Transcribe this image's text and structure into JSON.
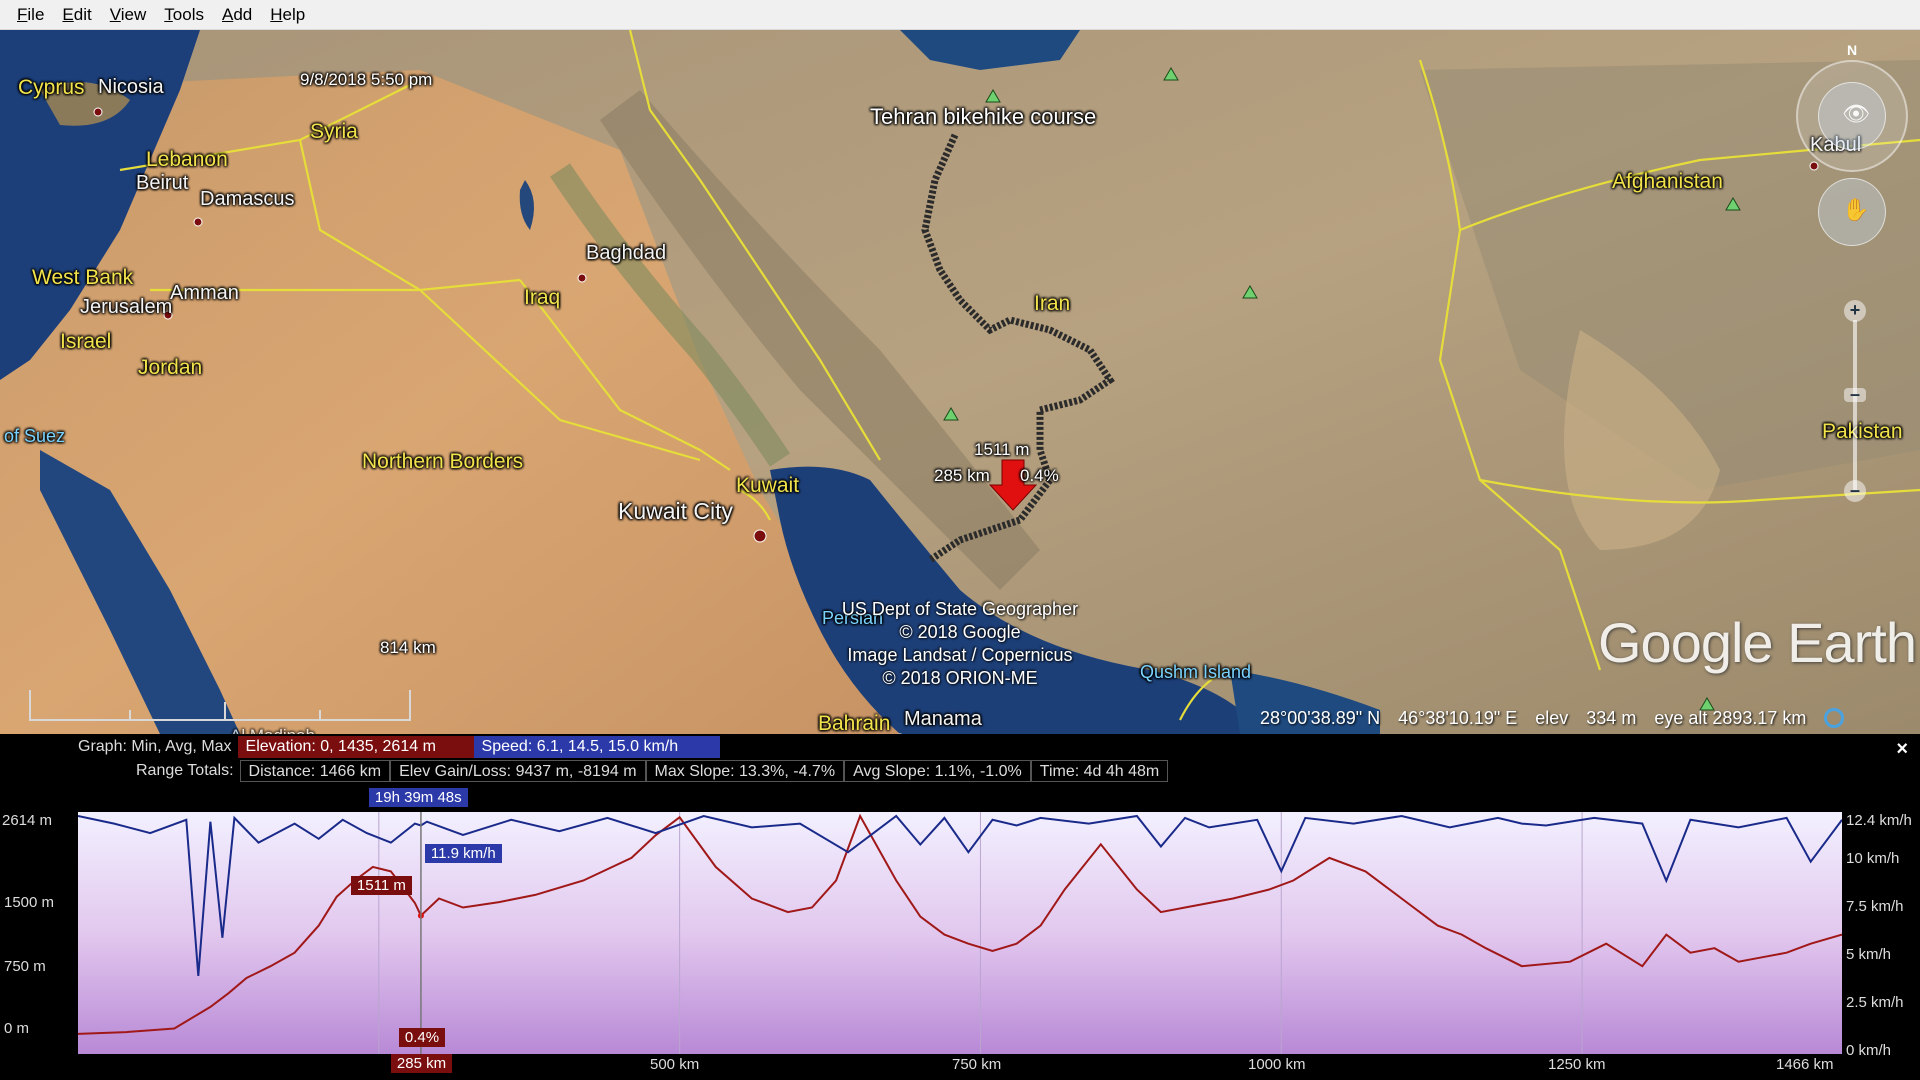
{
  "menu": [
    "File",
    "Edit",
    "View",
    "Tools",
    "Add",
    "Help"
  ],
  "map": {
    "timestamp": "9/8/2018   5:50 pm",
    "scale_label": "814 km",
    "labels": {
      "cyprus": "Cyprus",
      "nicosia": "Nicosia",
      "syria": "Syria",
      "lebanon": "Lebanon",
      "beirut": "Beirut",
      "damascus": "Damascus",
      "west_bank": "West Bank",
      "amman": "Amman",
      "jerusalem": "Jerusalem",
      "israel": "Israel",
      "jordan": "Jordan",
      "suez": "of Suez",
      "baghdad": "Baghdad",
      "iraq": "Iraq",
      "tehran_course": "Tehran bikehike course",
      "iran": "Iran",
      "afghanistan": "Afghanistan",
      "kabul": "Kabul",
      "pakistan": "Pakistan",
      "northern_borders": "Northern Borders",
      "kuwait": "Kuwait",
      "kuwait_city": "Kuwait City",
      "persian_gulf": "Persian",
      "qushm_island": "Qushm Island",
      "bahrain": "Bahrain",
      "manama": "Manama",
      "al_madinah": "Al Madinah"
    },
    "marker": {
      "elevation": "1511 m",
      "distance": "285 km",
      "slope": "0.4%"
    },
    "credits": [
      "US Dept of State Geographer",
      "© 2018 Google",
      "Image Landsat / Copernicus",
      "© 2018 ORION-ME"
    ],
    "logo": "Google Earth",
    "status": {
      "lat": "28°00'38.89\" N",
      "lon": "46°38'10.19\" E",
      "elev_label": "elev",
      "elev_value": "334 m",
      "eye_alt": "eye alt 2893.17 km"
    },
    "compass_north": "N"
  },
  "panel": {
    "graph_label": "Graph: Min, Avg, Max",
    "elevation_chip": "Elevation: 0, 1435, 2614 m",
    "speed_chip": "Speed: 6.1, 14.5, 15.0 km/h",
    "range_label": "Range Totals:",
    "totals": [
      "Distance: 1466 km",
      "Elev Gain/Loss: 9437 m, -8194 m",
      "Max Slope: 13.3%, -4.7%",
      "Avg Slope: 1.1%, -1.0%",
      "Time: 4d 4h 48m"
    ],
    "cursor_time": "19h 39m 48s",
    "cursor_speed": "11.9 km/h",
    "cursor_elev": "1511 m",
    "cursor_slope": "0.4%",
    "cursor_dist": "285 km",
    "close": "×"
  },
  "chart_data": {
    "type": "line",
    "x_unit": "km",
    "xlim": [
      0,
      1466
    ],
    "x_ticks": [
      "500 km",
      "750 km",
      "1000 km",
      "1250 km",
      "1466 km"
    ],
    "y_left_ticks": [
      "2614 m",
      "1500 m",
      "750 m",
      "0 m"
    ],
    "y_right_ticks": [
      "12.4 km/h",
      "10 km/h",
      "7.5 km/h",
      "5 km/h",
      "2.5 km/h",
      "0 km/h"
    ],
    "ylim_left": [
      0,
      2614
    ],
    "ylim_right": [
      0,
      12.4
    ],
    "series": [
      {
        "name": "Elevation",
        "color": "#a01818",
        "x": [
          0,
          40,
          80,
          110,
          125,
          140,
          160,
          180,
          200,
          215,
          230,
          245,
          260,
          280,
          285,
          300,
          320,
          350,
          380,
          420,
          460,
          480,
          500,
          530,
          560,
          590,
          610,
          630,
          650,
          680,
          700,
          720,
          740,
          760,
          780,
          800,
          820,
          850,
          880,
          900,
          920,
          940,
          960,
          990,
          1010,
          1040,
          1070,
          1100,
          1130,
          1150,
          1170,
          1200,
          1240,
          1270,
          1300,
          1320,
          1340,
          1360,
          1380,
          1400,
          1420,
          1440,
          1466
        ],
        "y": [
          200,
          220,
          260,
          500,
          650,
          820,
          950,
          1100,
          1400,
          1720,
          1900,
          2050,
          2000,
          1650,
          1511,
          1700,
          1600,
          1660,
          1740,
          1900,
          2150,
          2400,
          2600,
          2050,
          1700,
          1550,
          1600,
          1900,
          2614,
          1900,
          1500,
          1300,
          1200,
          1120,
          1200,
          1400,
          1800,
          2300,
          1800,
          1550,
          1600,
          1650,
          1700,
          1800,
          1900,
          2150,
          2000,
          1700,
          1400,
          1300,
          1150,
          950,
          1000,
          1200,
          950,
          1300,
          1100,
          1150,
          1000,
          1050,
          1100,
          1200,
          1300
        ]
      },
      {
        "name": "Speed",
        "color": "#1a2a8a",
        "x": [
          0,
          30,
          60,
          90,
          100,
          110,
          120,
          130,
          150,
          180,
          200,
          220,
          240,
          260,
          280,
          285,
          290,
          320,
          360,
          400,
          440,
          480,
          520,
          560,
          600,
          640,
          680,
          700,
          720,
          740,
          760,
          780,
          800,
          840,
          880,
          900,
          920,
          940,
          980,
          1000,
          1020,
          1060,
          1100,
          1140,
          1180,
          1200,
          1220,
          1260,
          1300,
          1320,
          1340,
          1380,
          1420,
          1440,
          1466
        ],
        "y": [
          12.4,
          12.0,
          11.5,
          12.2,
          4.0,
          12.1,
          6.0,
          12.3,
          11.0,
          12.0,
          11.2,
          12.2,
          11.5,
          11.0,
          12.0,
          11.9,
          12.1,
          11.4,
          12.2,
          11.6,
          12.3,
          11.5,
          12.4,
          11.8,
          12.0,
          10.5,
          12.4,
          10.9,
          12.3,
          10.5,
          12.2,
          11.9,
          12.3,
          12.0,
          12.4,
          10.8,
          12.3,
          11.8,
          12.2,
          9.5,
          12.3,
          12.0,
          12.4,
          11.8,
          12.3,
          12.0,
          11.9,
          12.3,
          12.0,
          9.0,
          12.2,
          11.8,
          12.3,
          10.0,
          12.2
        ]
      }
    ],
    "cursor_x": 285
  }
}
